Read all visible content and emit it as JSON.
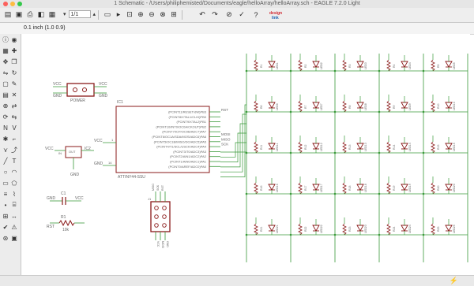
{
  "window": {
    "title": "1 Schematic - /Users/philiphemisted/Documents/eagle/helloArray/helloArray.sch - EAGLE 7.2.0 Light",
    "traffic_lights": [
      "close",
      "minimize",
      "zoom"
    ]
  },
  "toolbar": {
    "page_value": "1/1",
    "icons": [
      "open-icon",
      "save-icon",
      "print-icon",
      "cam-icon",
      "board-icon",
      "page-down-icon",
      "page-up-icon",
      "script-icon",
      "run-icon",
      "zoom-fit-icon",
      "zoom-in-icon",
      "zoom-out-icon",
      "zoom-redraw-icon",
      "zoom-select-icon",
      "undo-icon",
      "redo-icon",
      "stop-icon",
      "go-icon",
      "help-icon",
      "design-link-icon"
    ]
  },
  "coordinates": {
    "readout": "0.1 inch (1.0 0.9)"
  },
  "schematic": {
    "power_header": {
      "label": "POWER",
      "pin_top": "VCC",
      "pin_bottom": "GND"
    },
    "mcu": {
      "name": "IC1",
      "part": "ATTINY44-SSU",
      "vcc": "VCC",
      "gnd": "GND",
      "pin_vcc": "1",
      "pin_gnd": "14",
      "pins": [
        "(PCINT11/RESET/dW)PB3",
        "(PCINT8/XTAL1/CLKI)PB0",
        "(PCINT9/XTAL2)PB1",
        "(PCINT10/INT0/OC0A/CKOUT)PB2",
        "(PCINT7/ICP/OC0B/ADC7)PA7",
        "(PCINT6/OC1A/SDA/MOSI/ADC6)PA6",
        "(PCINT5/OC1B/MISO/DO/ADC5)PA5",
        "(PCINT4/T1/SCL/USCK/ADC4)PA4",
        "(PCINT3/T0/ADC3)PA3",
        "(PCINT2/AIN1/ADC2)PA2",
        "(PCINT1/AIN0/ADC1)PA1",
        "(PCINT0/AREF/ADC0)PA0"
      ],
      "net_labels": [
        "RST",
        "MOSI",
        "MISO",
        "SCK"
      ]
    },
    "regulator": {
      "name": "IC2",
      "pins": [
        "VCC",
        "IN",
        "OUT",
        "GND"
      ]
    },
    "capacitor": {
      "name": "C1",
      "left": "GND",
      "right": "VCC"
    },
    "resistor": {
      "name": "R1",
      "left": "RST",
      "right": "10k"
    },
    "isp_header": {
      "name": "J1",
      "pins": [
        "MISO",
        "SCK",
        "RST",
        "VCC",
        "MOSI",
        "GND"
      ]
    },
    "led_matrix": {
      "rows": 5,
      "cols": 5,
      "led_prefix": "LED",
      "res_prefix": "R"
    }
  },
  "status": {
    "text": "",
    "icon": "grid-status-icon"
  }
}
